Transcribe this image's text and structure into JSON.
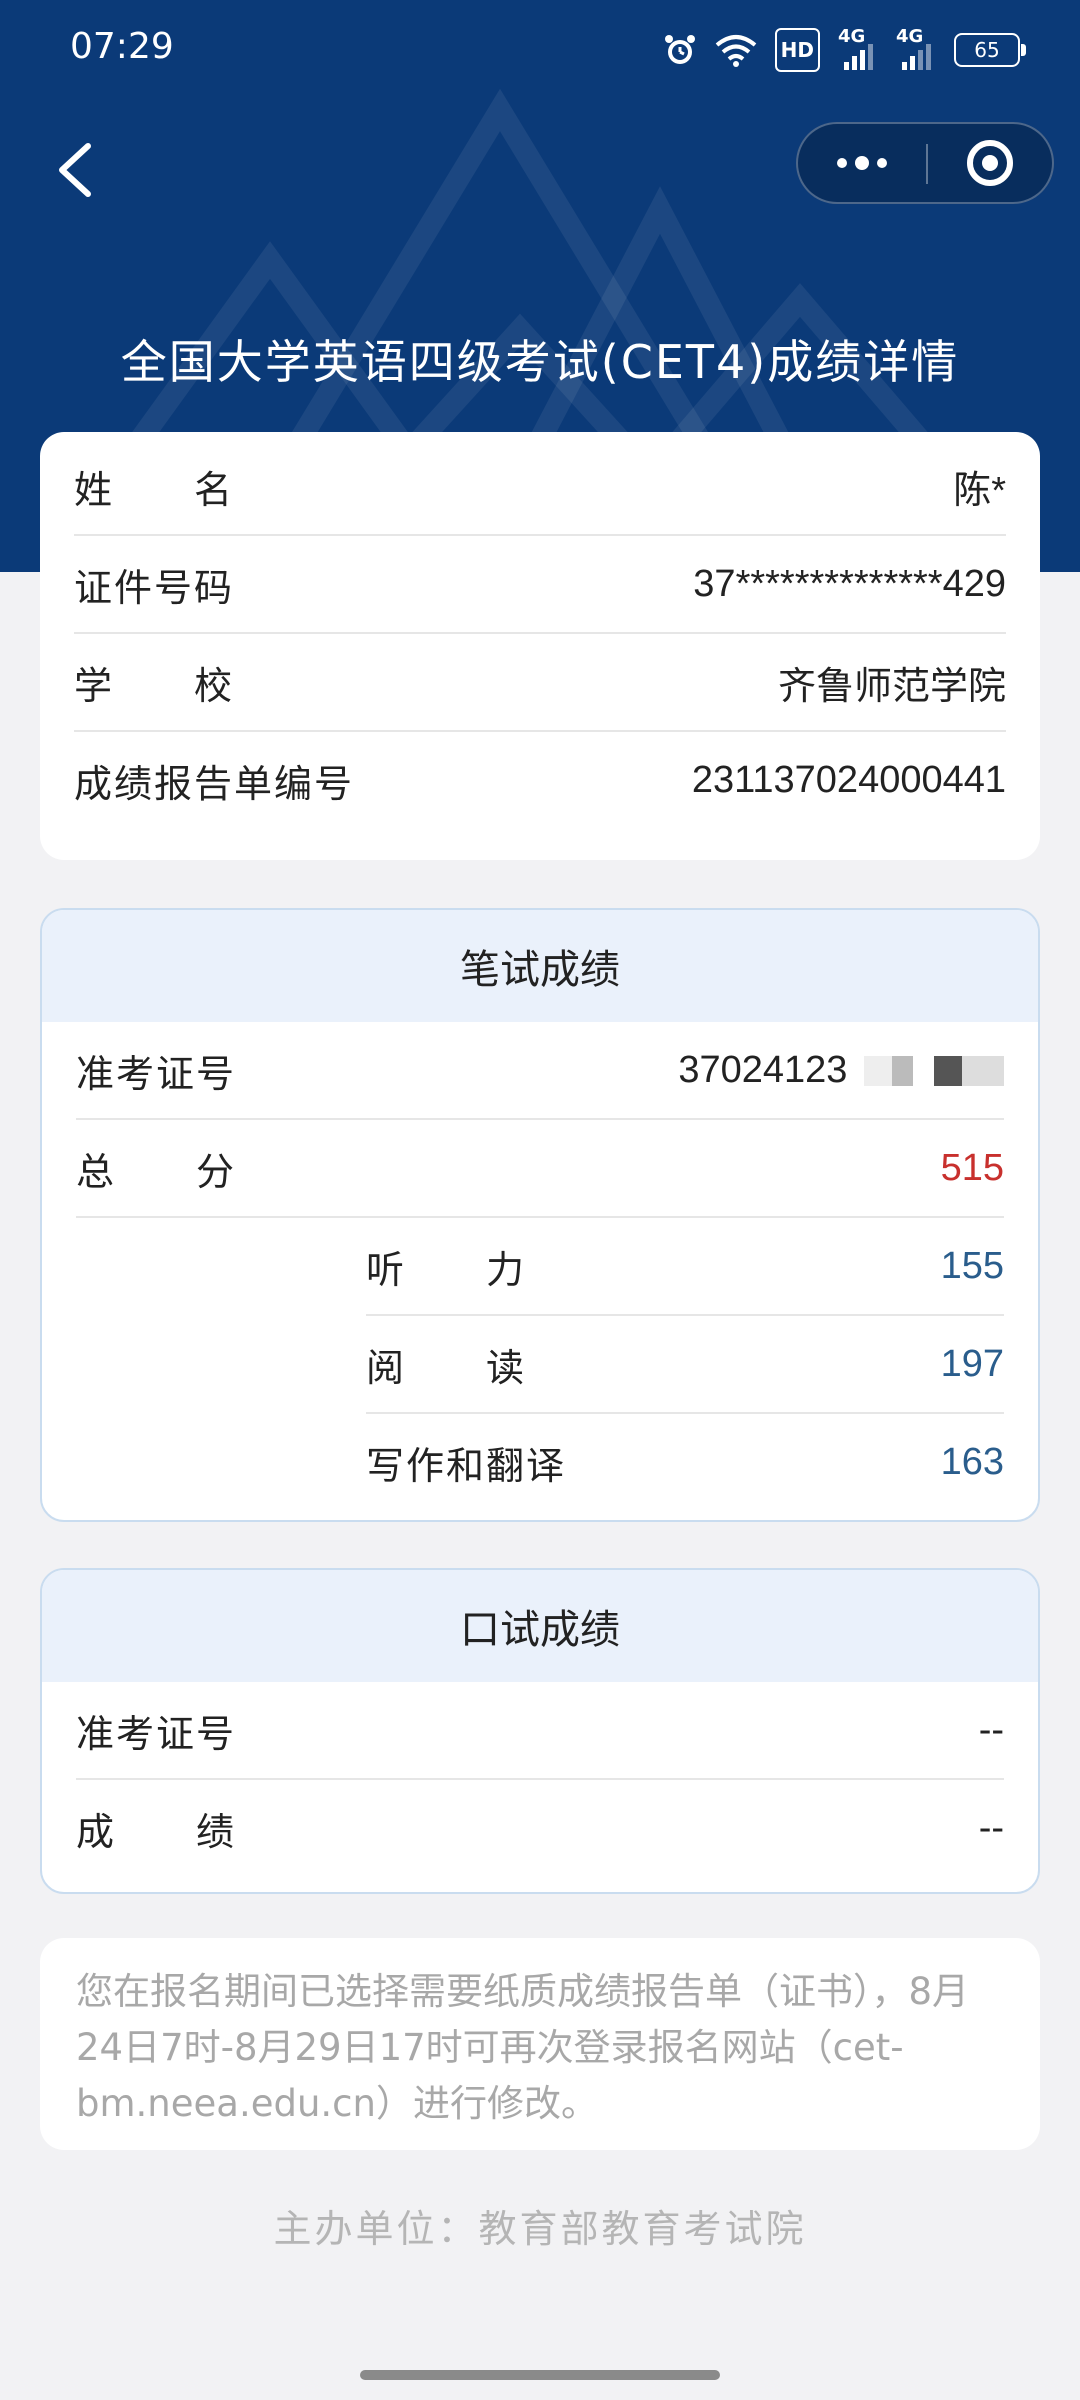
{
  "status_bar": {
    "time": "07:29",
    "hd_label": "HD",
    "net1": "4G",
    "net2": "4G",
    "battery": "65"
  },
  "page": {
    "title": "全国大学英语四级考试(CET4)成绩详情"
  },
  "personal_info": {
    "rows": [
      {
        "label": "姓　　名",
        "value": "陈*"
      },
      {
        "label": "证件号码",
        "value": "37**************429"
      },
      {
        "label": "学　　校",
        "value": "齐鲁师范学院"
      },
      {
        "label": "成绩报告单编号",
        "value": "231137024000441"
      }
    ]
  },
  "written_exam": {
    "title": "笔试成绩",
    "ticket_label": "准考证号",
    "ticket_value": "37024123",
    "total_label": "总　　分",
    "total_value": "515",
    "sub_scores": [
      {
        "label": "听　　力",
        "value": "155"
      },
      {
        "label": "阅　　读",
        "value": "197"
      },
      {
        "label": "写作和翻译",
        "value": "163"
      }
    ]
  },
  "oral_exam": {
    "title": "口试成绩",
    "ticket_label": "准考证号",
    "ticket_value": "--",
    "score_label": "成　　绩",
    "score_value": "--"
  },
  "notice": {
    "text": "您在报名期间已选择需要纸质成绩报告单（证书），8月24日7时-8月29日17时可再次登录报名网站（cet-bm.neea.edu.cn）进行修改。"
  },
  "footer": {
    "text": "主办单位：教育部教育考试院"
  },
  "colors": {
    "header_bg": "#0b3a78",
    "total_score": "#c8302d",
    "sub_score": "#2a5d8c"
  }
}
